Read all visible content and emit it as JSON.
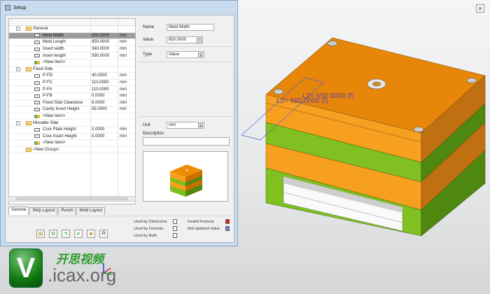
{
  "window": {
    "title": "Setup"
  },
  "tree": {
    "groups": [
      {
        "label": "General",
        "items": [
          {
            "name": "Mold Width",
            "value": "650.0000",
            "unit": "mm",
            "selected": true
          },
          {
            "name": "Mold Length",
            "value": "850.0000",
            "unit": "mm"
          },
          {
            "name": "Insert width",
            "value": "340.0000",
            "unit": "mm"
          },
          {
            "name": "Insert length",
            "value": "590.0000",
            "unit": "mm"
          }
        ],
        "new_item": "<New Item>"
      },
      {
        "label": "Fixed Side",
        "items": [
          {
            "name": "P-FD",
            "value": "40.0000",
            "unit": "mm"
          },
          {
            "name": "P-FC",
            "value": "110.0000",
            "unit": "mm"
          },
          {
            "name": "P-FA",
            "value": "110.0000",
            "unit": "mm"
          },
          {
            "name": "P-FB",
            "value": "0.0000",
            "unit": "mm"
          },
          {
            "name": "Fixed Side Clearance",
            "value": "6.0000",
            "unit": "mm"
          },
          {
            "name": "Cavity Insert Height",
            "value": "65.0000",
            "unit": "mm"
          }
        ],
        "new_item": "<New Item>"
      },
      {
        "label": "Movable Side",
        "items": [
          {
            "name": "Core Plate Height",
            "value": "0.0000",
            "unit": "mm"
          },
          {
            "name": "Core Insert Height",
            "value": "0.0000",
            "unit": "mm"
          }
        ],
        "new_item": "<New Item>"
      }
    ],
    "new_group": "<New Group>"
  },
  "props": {
    "name_label": "Name",
    "name_value": "Mold Width",
    "value_label": "Value",
    "value_value": "650.0000",
    "type_label": "Type",
    "type_value": "Value",
    "unit_label": "Unit",
    "unit_value": "mm",
    "description_label": "Description",
    "description_value": ""
  },
  "tabs": [
    "General",
    "Strip Layout",
    "Punch",
    "Mold Layout"
  ],
  "legend": {
    "used_by_dimension": "Used by Dimension",
    "used_by_formula": "Used by Formula",
    "used_by_both": "Used by Both",
    "invalid_formula": "Invalid Formula",
    "not_updated_value": "Not Updated Value",
    "invalid_color": "#e02020",
    "not_updated_color": "#6a7fd8"
  },
  "viewport": {
    "dim1": "L2= 650.0000 (f)",
    "dim2": "L2= 650.0000 (f)"
  },
  "watermark": {
    "logo_letter": "V",
    "chinese": "开思视频",
    "url": ".icax.org"
  }
}
